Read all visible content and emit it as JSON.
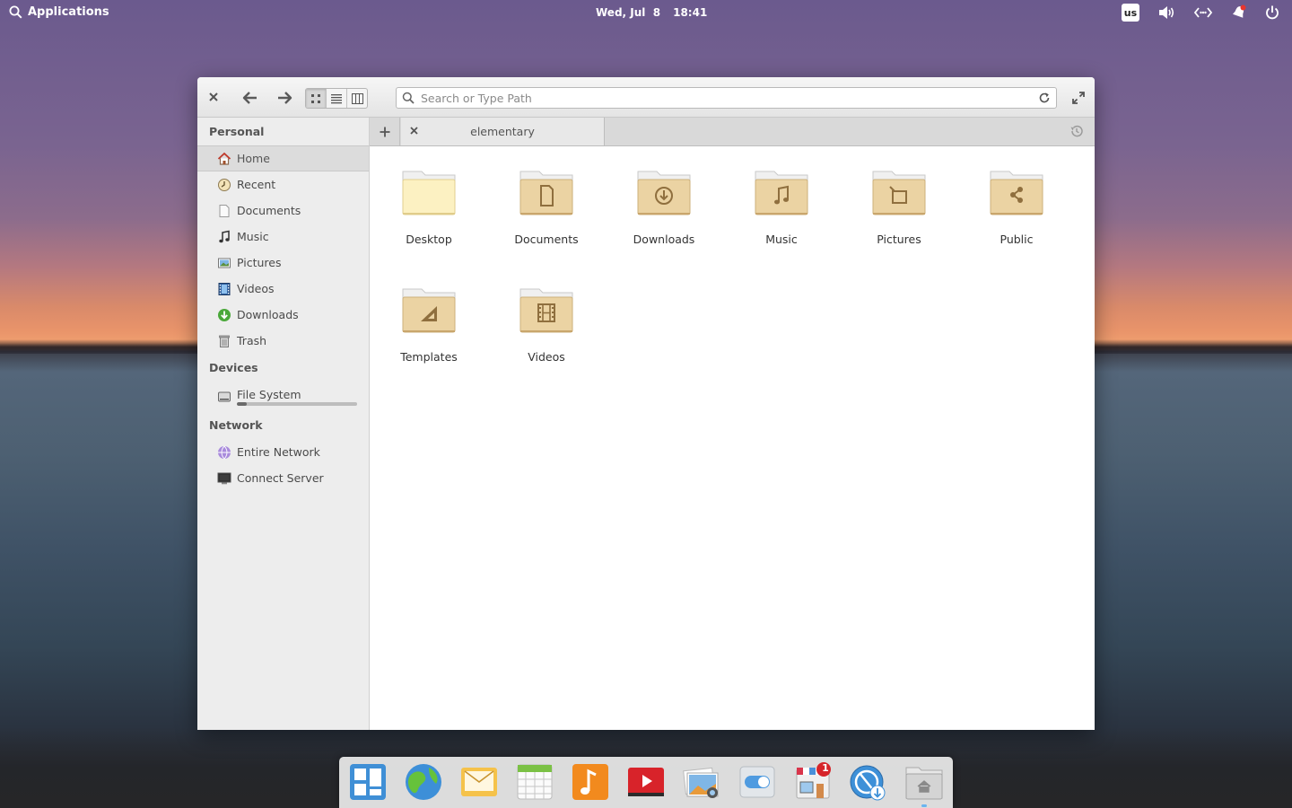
{
  "panel": {
    "applications_label": "Applications",
    "date": "Wed, Jul  8",
    "time": "18:41",
    "keyboard_layout": "us"
  },
  "window": {
    "search": {
      "placeholder": "Search or Type Path",
      "value": ""
    },
    "tab": {
      "label": "elementary"
    },
    "view_mode": "icon"
  },
  "sidebar": {
    "personal": {
      "heading": "Personal",
      "items": [
        {
          "label": "Home",
          "icon": "home-icon",
          "selected": true
        },
        {
          "label": "Recent",
          "icon": "recent-icon"
        },
        {
          "label": "Documents",
          "icon": "document-icon"
        },
        {
          "label": "Music",
          "icon": "music-icon"
        },
        {
          "label": "Pictures",
          "icon": "pictures-icon"
        },
        {
          "label": "Videos",
          "icon": "videos-icon"
        },
        {
          "label": "Downloads",
          "icon": "downloads-icon"
        },
        {
          "label": "Trash",
          "icon": "trash-icon"
        }
      ]
    },
    "devices": {
      "heading": "Devices",
      "items": [
        {
          "label": "File System",
          "icon": "drive-icon",
          "usage_fraction": 0.08
        }
      ]
    },
    "network": {
      "heading": "Network",
      "items": [
        {
          "label": "Entire Network",
          "icon": "network-icon"
        },
        {
          "label": "Connect Server",
          "icon": "server-icon"
        }
      ]
    }
  },
  "folders": [
    {
      "label": "Desktop",
      "emblem": "none"
    },
    {
      "label": "Documents",
      "emblem": "document"
    },
    {
      "label": "Downloads",
      "emblem": "download"
    },
    {
      "label": "Music",
      "emblem": "music"
    },
    {
      "label": "Pictures",
      "emblem": "picture"
    },
    {
      "label": "Public",
      "emblem": "share"
    },
    {
      "label": "Templates",
      "emblem": "template"
    },
    {
      "label": "Videos",
      "emblem": "video"
    }
  ],
  "dock": {
    "apps": [
      {
        "name": "multitasking-view-icon"
      },
      {
        "name": "web-browser-icon"
      },
      {
        "name": "mail-icon"
      },
      {
        "name": "calendar-icon"
      },
      {
        "name": "music-player-icon"
      },
      {
        "name": "videos-player-icon"
      },
      {
        "name": "photos-icon"
      },
      {
        "name": "system-settings-icon"
      },
      {
        "name": "app-center-icon",
        "badge": "1"
      },
      {
        "name": "download-manager-icon"
      },
      {
        "name": "files-icon",
        "running": true
      }
    ]
  },
  "colors": {
    "folder_body": "#e8cf9c",
    "folder_back": "#f0f0f0",
    "desktop_folder_body": "#fbf0c0",
    "accent": "#6ab4f0",
    "badge": "#d6252a"
  }
}
